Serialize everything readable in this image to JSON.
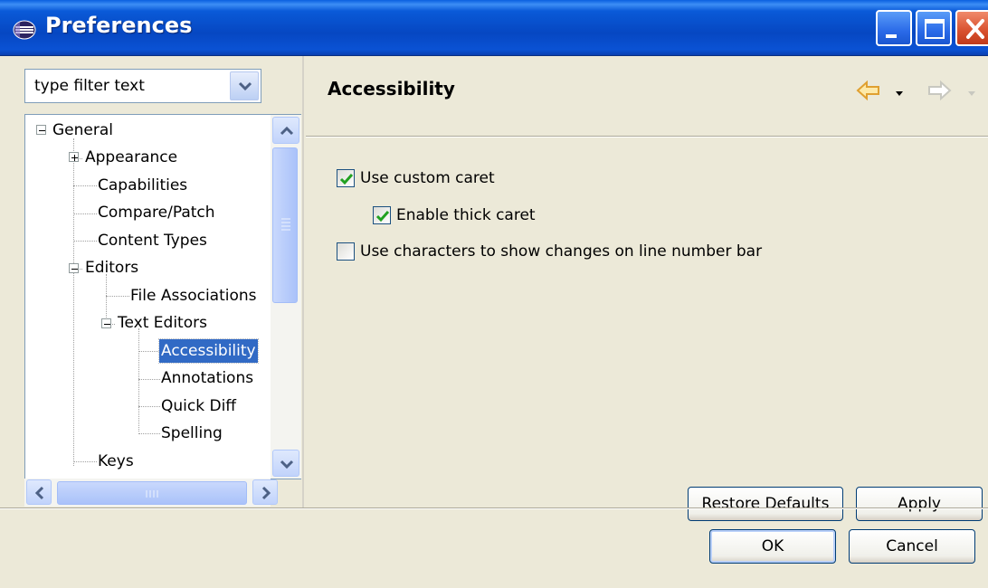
{
  "window": {
    "title": "Preferences",
    "icon": "eclipse-icon"
  },
  "filter": {
    "placeholder": "type filter text",
    "value": "type filter text"
  },
  "tree": {
    "items": [
      {
        "label": "General",
        "expanded": true
      },
      {
        "label": "Appearance",
        "expanded": false
      },
      {
        "label": "Capabilities"
      },
      {
        "label": "Compare/Patch"
      },
      {
        "label": "Content Types"
      },
      {
        "label": "Editors",
        "expanded": true
      },
      {
        "label": "File Associations"
      },
      {
        "label": "Text Editors",
        "expanded": true
      },
      {
        "label": "Accessibility",
        "selected": true
      },
      {
        "label": "Annotations"
      },
      {
        "label": "Quick Diff"
      },
      {
        "label": "Spelling"
      },
      {
        "label": "Keys"
      }
    ]
  },
  "page": {
    "title": "Accessibility",
    "options": [
      {
        "label": "Use custom caret",
        "checked": true
      },
      {
        "label": "Enable thick caret",
        "checked": true
      },
      {
        "label": "Use characters to show changes on line number bar",
        "checked": false
      }
    ],
    "restore_defaults": "Restore Defaults",
    "apply": "Apply"
  },
  "dialog": {
    "ok": "OK",
    "cancel": "Cancel"
  },
  "colors": {
    "titlebar": "#0a52d4",
    "selection": "#316ac5",
    "window_bg": "#ece9d8",
    "check_mark": "#21a121",
    "nav_arrow": "#e8a020"
  }
}
